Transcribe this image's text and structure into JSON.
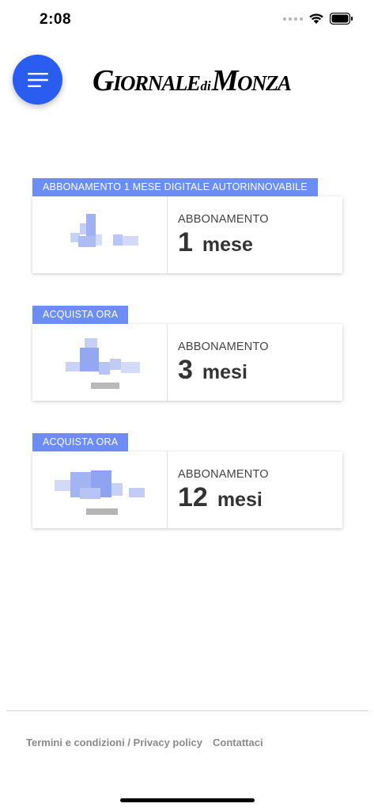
{
  "status_bar": {
    "time": "2:08"
  },
  "header": {
    "logo_big_1": "G",
    "logo_small_1": "IORNALE",
    "logo_di": "di",
    "logo_big_2": "M",
    "logo_small_2": "ONZA",
    "menu_icon": "hamburger-menu-icon",
    "accent_color": "#2a5cf0"
  },
  "plans": [
    {
      "badge": "ABBONAMENTO 1 MESE DIGITALE AUTORINNOVABILE",
      "label": "ABBONAMENTO",
      "number": "1",
      "unit": "mese"
    },
    {
      "badge": "ACQUISTA ORA",
      "label": "ABBONAMENTO",
      "number": "3",
      "unit": "mesi"
    },
    {
      "badge": "ACQUISTA ORA",
      "label": "ABBONAMENTO",
      "number": "12",
      "unit": "mesi"
    }
  ],
  "badge_color": "#6c8df5",
  "footer": {
    "terms": "Termini e condizioni / Privacy policy",
    "contact": "Contattaci"
  }
}
